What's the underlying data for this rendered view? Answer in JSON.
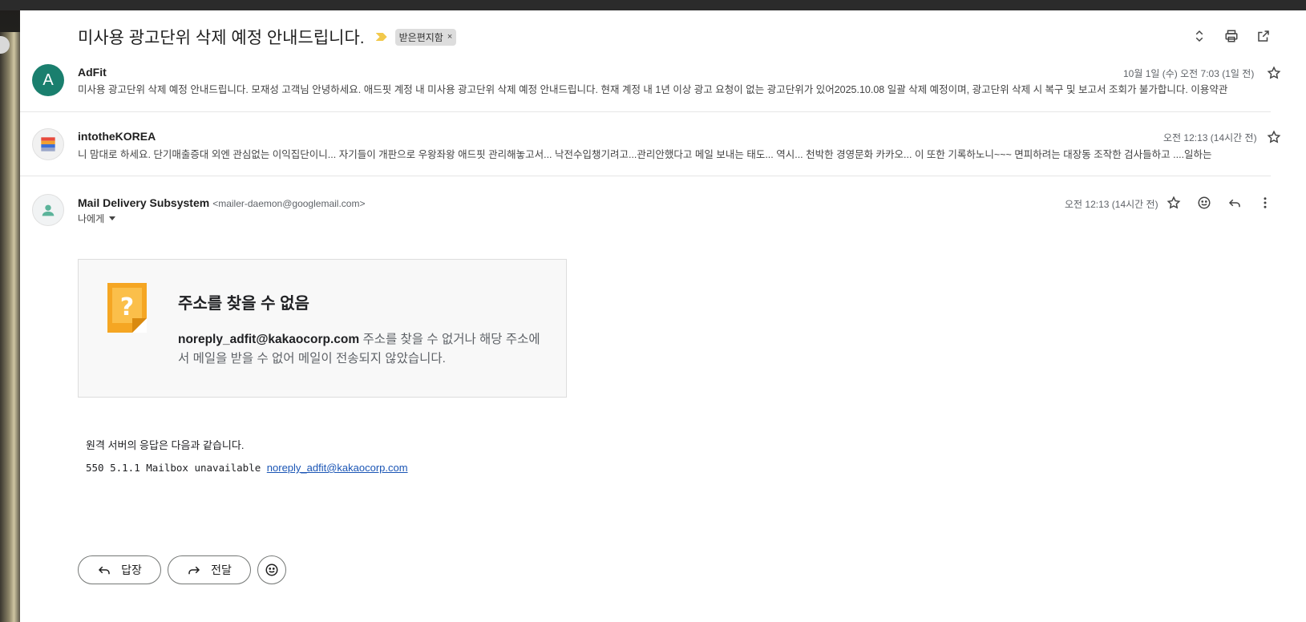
{
  "thread": {
    "subject": "미사용 광고단위 삭제 예정 안내드립니다.",
    "label": "받은편지함",
    "label_remove": "×"
  },
  "messages": [
    {
      "avatar_letter": "A",
      "sender": "AdFit",
      "time": "10월 1일 (수) 오전 7:03 (1일 전)",
      "snippet": "미사용 광고단위 삭제 예정 안내드립니다. 모재성 고객님 안녕하세요. 애드핏 계정 내 미사용 광고단위 삭제 예정 안내드립니다. 현재 계정 내 1년 이상 광고 요청이 없는 광고단위가 있어2025.10.08 일괄 삭제 예정이며, 광고단위 삭제 시 복구 및 보고서 조회가 불가합니다. 이용약관"
    },
    {
      "sender": "intotheKOREA",
      "time": "오전 12:13 (14시간 전)",
      "snippet": "니 맘대로 하세요. 단기매출증대 외엔 관심없는 이익집단이니... 자기들이 개판으로 우왕좌왕 애드핏 관리해놓고서... 낙전수입챙기려고...관리안했다고 메일 보내는 태도... 역시... 천박한 경영문화 카카오... 이 또한 기록하노니~~~ 면피하려는 대장동 조작한 검사들하고 ....일하는"
    }
  ],
  "open_message": {
    "sender": "Mail Delivery Subsystem",
    "sender_email": "<mailer-daemon@googlemail.com>",
    "to": "나에게",
    "time": "오전 12:13 (14시간 전)",
    "bounce_title": "주소를 찾을 수 없음",
    "bounce_address": "noreply_adfit@kakaocorp.com",
    "bounce_text": " 주소를 찾을 수 없거나 해당 주소에서 메일을 받을 수 없어 메일이 전송되지 않았습니다.",
    "remote_label": "원격 서버의 응답은 다음과 같습니다.",
    "smtp_code": "550 5.1.1 Mailbox unavailable ",
    "smtp_link": "noreply_adfit@kakaocorp.com"
  },
  "actions": {
    "reply": "답장",
    "forward": "전달"
  },
  "colors": {
    "avatar_a": "#1a7f6e",
    "importance": "#f2c94c",
    "bounce_icon": "#f5a623",
    "link": "#1a55b5"
  }
}
